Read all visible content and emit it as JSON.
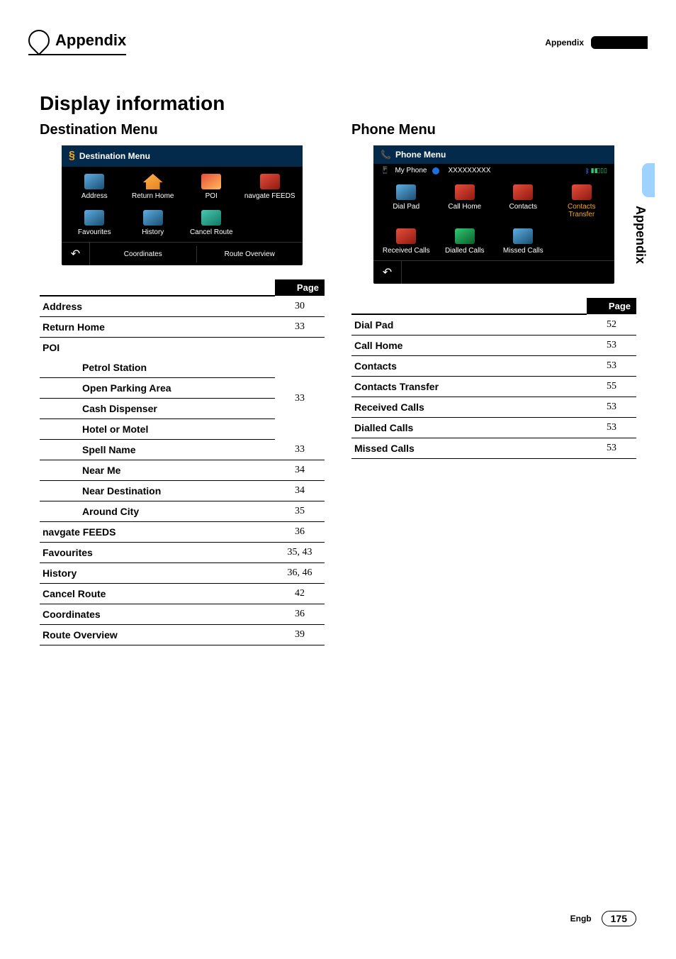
{
  "header": {
    "appendix": "Appendix",
    "chapter_tab": "Appendix"
  },
  "main_title": "Display information",
  "left": {
    "subtitle": "Destination Menu",
    "screenshot": {
      "title": "Destination Menu",
      "icons": [
        {
          "label": "Address"
        },
        {
          "label": "Return Home"
        },
        {
          "label": "POI"
        },
        {
          "label": "navgate FEEDS"
        },
        {
          "label": "Favourites"
        },
        {
          "label": "History"
        },
        {
          "label": "Cancel Route"
        }
      ],
      "bottom": {
        "back": "↶",
        "center": "Coordinates",
        "right": "Route Overview"
      }
    },
    "table_header": "Page",
    "rows": [
      {
        "type": "row",
        "label": "Address",
        "page": "30"
      },
      {
        "type": "row",
        "label": "Return Home",
        "page": "33"
      },
      {
        "type": "header",
        "label": "POI"
      },
      {
        "type": "group",
        "items": [
          "Petrol Station",
          "Open Parking Area",
          "Cash Dispenser",
          "Hotel or Motel"
        ],
        "page": "33"
      },
      {
        "type": "sub",
        "label": "Spell Name",
        "page": "33"
      },
      {
        "type": "sub",
        "label": "Near Me",
        "page": "34"
      },
      {
        "type": "sub",
        "label": "Near Destination",
        "page": "34"
      },
      {
        "type": "sub",
        "label": "Around City",
        "page": "35"
      },
      {
        "type": "row",
        "label": "navgate FEEDS",
        "page": "36"
      },
      {
        "type": "row",
        "label": "Favourites",
        "page": "35, 43"
      },
      {
        "type": "row",
        "label": "History",
        "page": "36, 46"
      },
      {
        "type": "row",
        "label": "Cancel Route",
        "page": "42"
      },
      {
        "type": "row",
        "label": "Coordinates",
        "page": "36"
      },
      {
        "type": "row",
        "label": "Route Overview",
        "page": "39"
      }
    ]
  },
  "right": {
    "subtitle": "Phone Menu",
    "screenshot": {
      "title": "Phone Menu",
      "sub": {
        "left": "My Phone",
        "mid": "XXXXXXXXX",
        "right": "▮◧▯▯"
      },
      "icons": [
        {
          "label": "Dial Pad"
        },
        {
          "label": "Call Home"
        },
        {
          "label": "Contacts"
        },
        {
          "label": "Contacts Transfer",
          "orange": true
        },
        {
          "label": "Received Calls"
        },
        {
          "label": "Dialled Calls"
        },
        {
          "label": "Missed Calls"
        }
      ],
      "bottom": {
        "back": "↶"
      }
    },
    "table_header": "Page",
    "rows": [
      {
        "label": "Dial Pad",
        "page": "52"
      },
      {
        "label": "Call Home",
        "page": "53"
      },
      {
        "label": "Contacts",
        "page": "53"
      },
      {
        "label": "Contacts Transfer",
        "page": "55"
      },
      {
        "label": "Received Calls",
        "page": "53"
      },
      {
        "label": "Dialled Calls",
        "page": "53"
      },
      {
        "label": "Missed Calls",
        "page": "53"
      }
    ]
  },
  "side_tab": "Appendix",
  "footer": {
    "lang": "Engb",
    "page": "175"
  }
}
